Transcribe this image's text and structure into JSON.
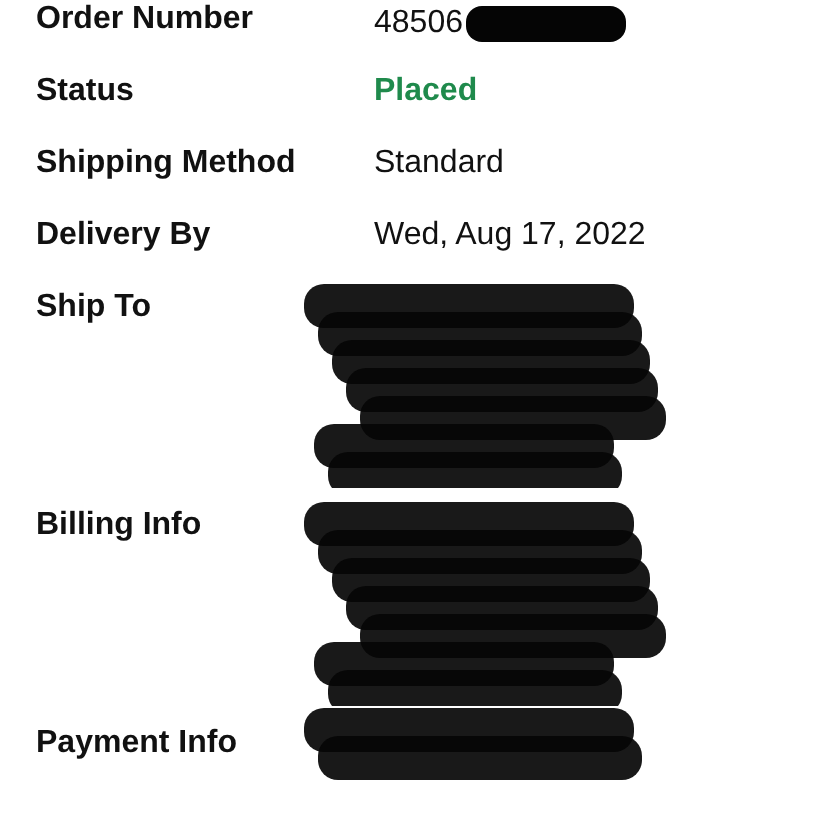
{
  "order_details": [
    {
      "label": "Order Number",
      "kind": "partly_redacted",
      "value": "48506"
    },
    {
      "label": "Status",
      "kind": "status",
      "value": "Placed"
    },
    {
      "label": "Shipping Method",
      "kind": "text",
      "value": "Standard"
    },
    {
      "label": "Delivery By",
      "kind": "text",
      "value": "Wed, Aug 17, 2022"
    },
    {
      "label": "Ship To",
      "kind": "redacted_tall"
    },
    {
      "label": "Billing Info",
      "kind": "redacted_tall"
    },
    {
      "label": "Payment Info",
      "kind": "redacted_short"
    }
  ]
}
